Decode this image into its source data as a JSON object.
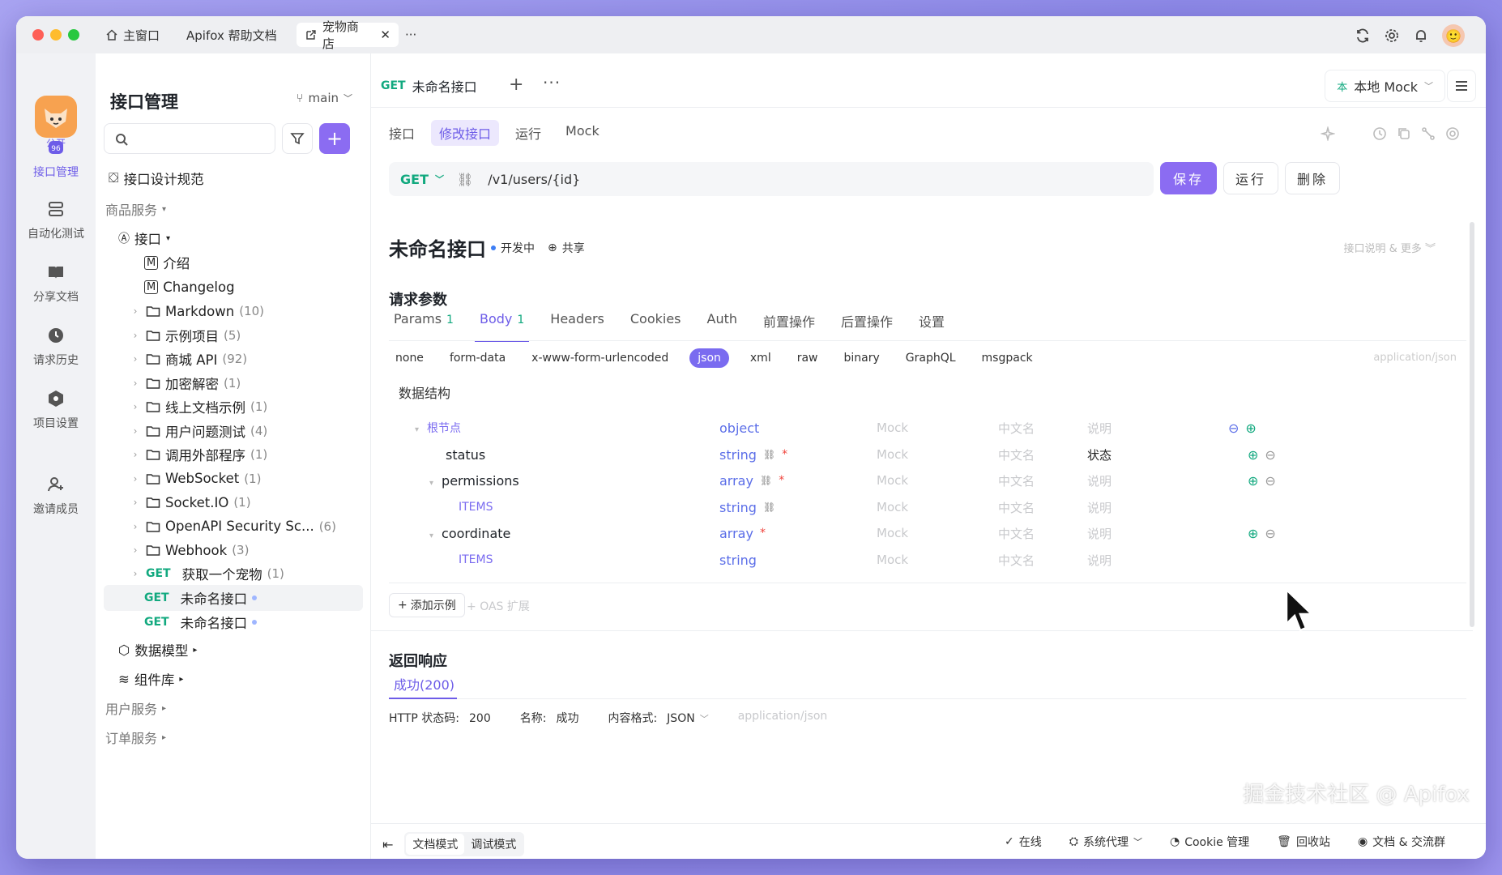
{
  "titlebar": {
    "tabs": [
      {
        "label": "主窗口"
      },
      {
        "label": "Apifox 帮助文档"
      },
      {
        "label": "宠物商店"
      }
    ]
  },
  "rail": {
    "public": "公开",
    "items": [
      "接口管理",
      "自动化测试",
      "分享文档",
      "请求历史",
      "项目设置",
      "邀请成员"
    ]
  },
  "sidebar": {
    "title": "接口管理",
    "branch": "main",
    "design_spec": "接口设计规范",
    "group_goods": "商品服务",
    "api_folder": "接口",
    "intro": "介绍",
    "changelog": "Changelog",
    "folders": [
      {
        "name": "Markdown",
        "count": "(10)"
      },
      {
        "name": "示例项目",
        "count": "(5)"
      },
      {
        "name": "商城 API",
        "count": "(92)"
      },
      {
        "name": "加密解密",
        "count": "(1)"
      },
      {
        "name": "线上文档示例",
        "count": "(1)"
      },
      {
        "name": "用户问题测试",
        "count": "(4)"
      },
      {
        "name": "调用外部程序",
        "count": "(1)"
      },
      {
        "name": "WebSocket",
        "count": "(1)"
      },
      {
        "name": "Socket.IO",
        "count": "(1)"
      },
      {
        "name": "OpenAPI Security Sc...",
        "count": "(6)"
      },
      {
        "name": "Webhook",
        "count": "(3)"
      }
    ],
    "get_pet": {
      "method": "GET",
      "name": "获取一个宠物",
      "count": "(1)"
    },
    "unnamed1": {
      "method": "GET",
      "name": "未命名接口"
    },
    "unnamed2": {
      "method": "GET",
      "name": "未命名接口"
    },
    "data_models": "数据模型",
    "components": "组件库",
    "group_user": "用户服务",
    "group_order": "订单服务"
  },
  "main": {
    "doc_tab": {
      "method": "GET",
      "name": "未命名接口"
    },
    "mock_env": "本地 Mock",
    "sub_tabs": [
      "接口",
      "修改接口",
      "运行",
      "Mock"
    ],
    "url": {
      "method": "GET",
      "path": "/v1/users/{id}"
    },
    "buttons": {
      "save": "保存",
      "run": "运行",
      "delete": "删除"
    },
    "api_title": "未命名接口",
    "status": "开发中",
    "share": "共享",
    "more_info": "接口说明 & 更多",
    "req_params_title": "请求参数",
    "req_tabs": [
      {
        "label": "Params",
        "n": "1"
      },
      {
        "label": "Body",
        "n": "1"
      },
      {
        "label": "Headers",
        "n": ""
      },
      {
        "label": "Cookies",
        "n": ""
      },
      {
        "label": "Auth",
        "n": ""
      },
      {
        "label": "前置操作",
        "n": ""
      },
      {
        "label": "后置操作",
        "n": ""
      },
      {
        "label": "设置",
        "n": ""
      }
    ],
    "body_types": [
      "none",
      "form-data",
      "x-www-form-urlencoded",
      "json",
      "xml",
      "raw",
      "binary",
      "GraphQL",
      "msgpack"
    ],
    "content_type": "application/json",
    "data_structure": "数据结构",
    "schema": [
      {
        "name": "根节点",
        "type": "object",
        "mock": "Mock",
        "cn": "中文名",
        "desc": "说明"
      },
      {
        "name": "status",
        "type": "string",
        "mock": "Mock",
        "cn": "中文名",
        "desc": "状态"
      },
      {
        "name": "permissions",
        "type": "array",
        "mock": "Mock",
        "cn": "中文名",
        "desc": "说明"
      },
      {
        "name": "ITEMS",
        "type": "string",
        "mock": "Mock",
        "cn": "中文名",
        "desc": "说明"
      },
      {
        "name": "coordinate",
        "type": "array",
        "mock": "Mock",
        "cn": "中文名",
        "desc": "说明"
      },
      {
        "name": "ITEMS",
        "type": "string",
        "mock": "Mock",
        "cn": "中文名",
        "desc": "说明"
      }
    ],
    "add_example": "添加示例",
    "oas_ext": "OAS 扩展",
    "resp_title": "返回响应",
    "resp_tab": "成功(200)",
    "resp_meta": {
      "http_label": "HTTP 状态码:",
      "http_val": "200",
      "name_label": "名称:",
      "name_val": "成功",
      "ctype_label": "内容格式:",
      "ctype_val": "JSON",
      "ctype_ph": "application/json"
    }
  },
  "footer": {
    "doc_mode": "文档模式",
    "debug_mode": "调试模式",
    "online": "在线",
    "proxy": "系统代理",
    "cookie": "Cookie 管理",
    "trash": "回收站",
    "community": "文档 & 交流群"
  },
  "watermark": "掘金技术社区 @ Apifox"
}
